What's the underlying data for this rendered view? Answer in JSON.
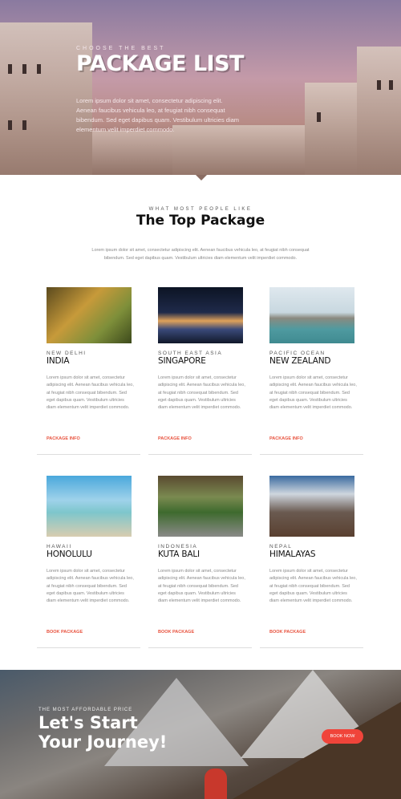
{
  "hero": {
    "kicker": "CHOOSE THE BEST",
    "title": "PACKAGE LIST",
    "text": "Lorem ipsum dolor sit amet, consectetur adipiscing elit. Aenean faucibus vehicula leo, at feugiat nibh consequat bibendum. Sed eget dapibus quam. Vestibulum ultricies diam elementum velit imperdiet commodo."
  },
  "section": {
    "kicker": "WHAT MOST PEOPLE LIKE",
    "title": "The Top Package",
    "text": "Lorem ipsum dolor sit amet, consectetur adipiscing elit. Aenean faucibus vehicula leo, at feugiat nibh consequat bibendum. Sed eget dapibus quam. Vestibulum ultricies diam elementum velit imperdiet commodo."
  },
  "cards": [
    {
      "location": "NEW DELHI",
      "name": "INDIA",
      "desc": "Lorem ipsum dolor sit amet, consectetur adipiscing elit. Aenean faucibus vehicula leo, at feugiat nibh consequat bibendum. Sed eget dapibus quam. Vestibulum ultricies diam elementum velit imperdiet commodo.",
      "link": "PACKAGE INFO"
    },
    {
      "location": "SOUTH EAST ASIA",
      "name": "SINGAPORE",
      "desc": "Lorem ipsum dolor sit amet, consectetur adipiscing elit. Aenean faucibus vehicula leo, at feugiat nibh consequat bibendum. Sed eget dapibus quam. Vestibulum ultricies diam elementum velit imperdiet commodo.",
      "link": "PACKAGE INFO"
    },
    {
      "location": "PACIFIC OCEAN",
      "name": "NEW ZEALAND",
      "desc": "Lorem ipsum dolor sit amet, consectetur adipiscing elit. Aenean faucibus vehicula leo, at feugiat nibh consequat bibendum. Sed eget dapibus quam. Vestibulum ultricies diam elementum velit imperdiet commodo.",
      "link": "PACKAGE INFO"
    },
    {
      "location": "HAWAII",
      "name": "HONOLULU",
      "desc": "Lorem ipsum dolor sit amet, consectetur adipiscing elit. Aenean faucibus vehicula leo, at feugiat nibh consequat bibendum. Sed eget dapibus quam. Vestibulum ultricies diam elementum velit imperdiet commodo.",
      "link": "BOOK PACKAGE"
    },
    {
      "location": "INDONESIA",
      "name": "KUTA BALI",
      "desc": "Lorem ipsum dolor sit amet, consectetur adipiscing elit. Aenean faucibus vehicula leo, at feugiat nibh consequat bibendum. Sed eget dapibus quam. Vestibulum ultricies diam elementum velit imperdiet commodo.",
      "link": "BOOK PACKAGE"
    },
    {
      "location": "NEPAL",
      "name": "HIMALAYAS",
      "desc": "Lorem ipsum dolor sit amet, consectetur adipiscing elit. Aenean faucibus vehicula leo, at feugiat nibh consequat bibendum. Sed eget dapibus quam. Vestibulum ultricies diam elementum velit imperdiet commodo.",
      "link": "BOOK PACKAGE"
    }
  ],
  "banner": {
    "kicker": "THE MOST AFFORDABLE PRICE",
    "title_line1": "Let's Start",
    "title_line2": "Your Journey!",
    "button": "BOOK NOW"
  },
  "colors": {
    "accent": "#e8533f",
    "button": "#f0443a"
  }
}
